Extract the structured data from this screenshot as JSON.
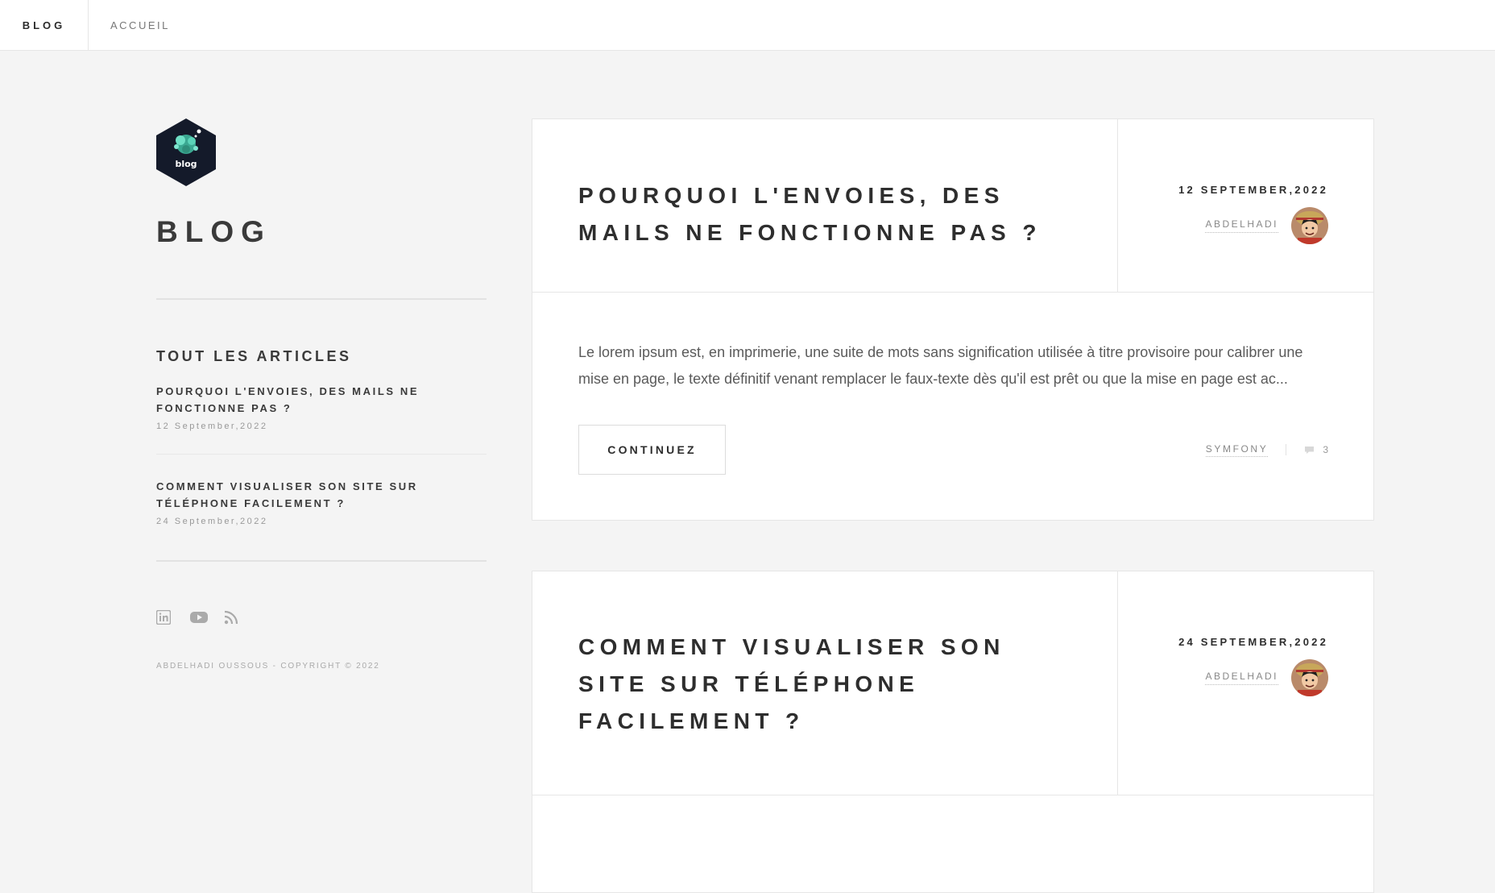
{
  "header": {
    "brand": "BLOG",
    "nav": [
      "ACCUEIL"
    ]
  },
  "sidebar": {
    "logo_text": "blog",
    "title": "BLOG",
    "recent_heading": "TOUT LES ARTICLES",
    "recent": [
      {
        "title": "Pourquoi l'envoies, des mails ne fonctionne pas ?",
        "date": "12 September,2022"
      },
      {
        "title": "Comment visualiser son site sur téléphone facilement ?",
        "date": "24 September,2022"
      }
    ],
    "socials": [
      "linkedin-icon",
      "youtube-icon",
      "rss-icon"
    ],
    "copyright": "ABDELHADI OUSSOUS - COPYRIGHT © 2022"
  },
  "posts": [
    {
      "title": "Pourquoi l'envoies, des mails ne fonctionne pas ?",
      "date": "12 SEPTEMBER,2022",
      "author": "ABDELHADI",
      "excerpt": "Le lorem ipsum est, en imprimerie, une suite de mots sans signification utilisée à titre provisoire pour calibrer une mise en page, le texte définitif venant remplacer le faux-texte dès qu'il est prêt ou que la mise en page est ac...",
      "button": "CONTINUEZ",
      "category": "SYMFONY",
      "comments": "3"
    },
    {
      "title": "Comment visualiser son site sur téléphone facilement ?",
      "date": "24 SEPTEMBER,2022",
      "author": "ABDELHADI"
    }
  ],
  "colors": {
    "background": "#f4f4f4",
    "card": "#ffffff",
    "text_dark": "#2e2e2e",
    "text_muted": "#888888",
    "logo_bg": "#141a2a",
    "logo_accent": "#4ec9b0"
  }
}
